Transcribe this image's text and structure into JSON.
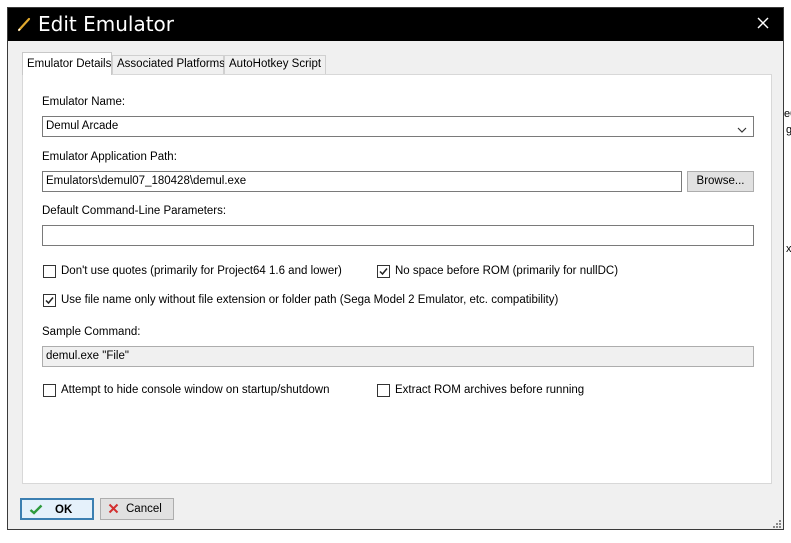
{
  "window": {
    "title": "Edit Emulator"
  },
  "tabs": [
    {
      "label": "Emulator Details",
      "active": true
    },
    {
      "label": "Associated Platforms",
      "active": false
    },
    {
      "label": "AutoHotkey Script",
      "active": false
    }
  ],
  "form": {
    "emulator_name_label": "Emulator Name:",
    "emulator_name_value": "Demul Arcade",
    "app_path_label": "Emulator Application Path:",
    "app_path_value": "Emulators\\demul07_180428\\demul.exe",
    "browse_label": "Browse...",
    "params_label": "Default Command-Line Parameters:",
    "params_value": "",
    "checkboxes": [
      {
        "label": "Don't use quotes (primarily for Project64 1.6 and lower)",
        "checked": false
      },
      {
        "label": "No space before ROM (primarily for nullDC)",
        "checked": true
      },
      {
        "label": "Use file name only without file extension or folder path (Sega Model 2 Emulator, etc. compatibility)",
        "checked": true
      },
      {
        "label": "Attempt to hide console window on startup/shutdown",
        "checked": false
      },
      {
        "label": "Extract ROM archives before running",
        "checked": false
      }
    ],
    "sample_label": "Sample Command:",
    "sample_value": "demul.exe \"File\""
  },
  "buttons": {
    "ok": "OK",
    "cancel": "Cancel"
  },
  "background_fragments": [
    "e0",
    "g",
    "x"
  ],
  "colors": {
    "titlebar": "#000000",
    "ok_check": "#2e9a3c",
    "cancel_x": "#d32f2f",
    "pencil": "#e0a82e"
  }
}
